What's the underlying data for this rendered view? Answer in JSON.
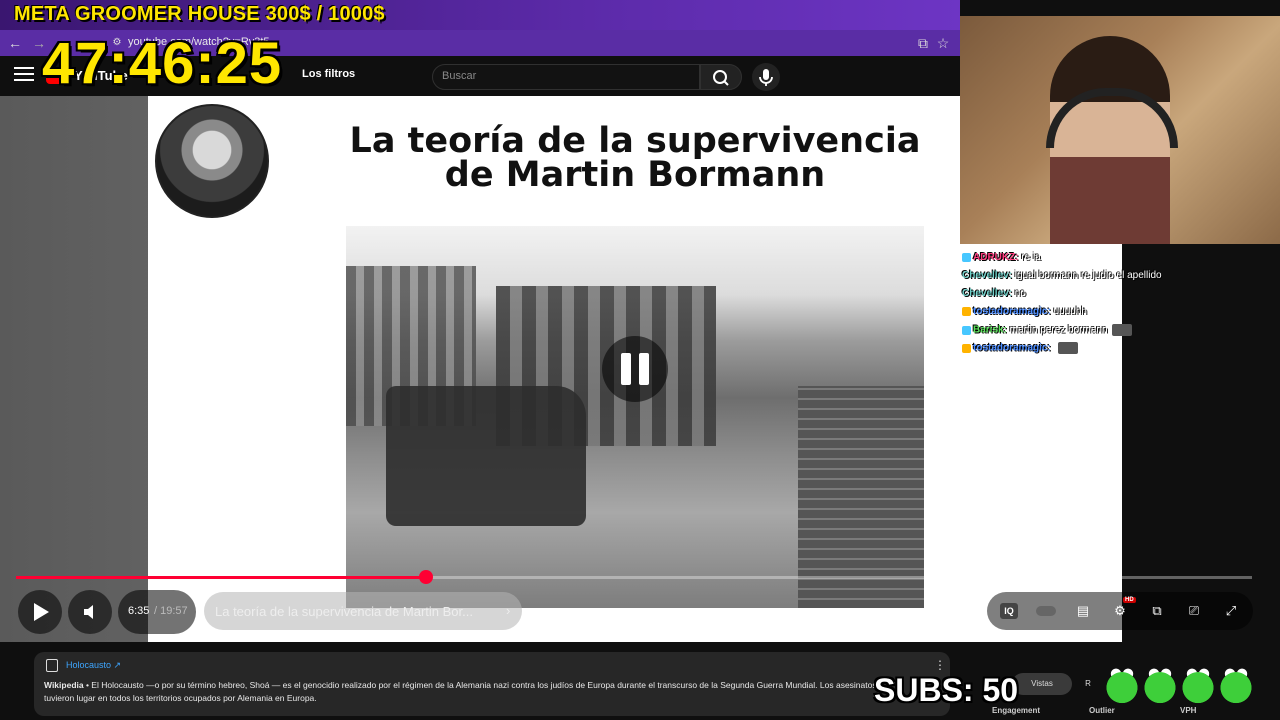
{
  "stream_overlay": {
    "banner": "META GROOMER HOUSE 300$ / 1000$",
    "timer": "47:46:25",
    "subs": "SUBS: 50"
  },
  "browser": {
    "url": "youtube.com/watch?v=Rv3t5..."
  },
  "youtube_header": {
    "logo_text": "YouTube",
    "filters_label": "Los filtros",
    "search_placeholder": "Buscar"
  },
  "slide": {
    "title_line1": "La teoría de la supervivencia",
    "title_line2": "de Martin Bormann"
  },
  "player": {
    "current_time": "6:35",
    "total_time": "/ 19:57",
    "chapter": "La teoría de la supervivencia de Martin Bor...",
    "chapter_arrow": "›",
    "progress": 0.332
  },
  "chat": [
    {
      "name": "ADRUKZ",
      "message": "re ia",
      "color": "#ff3d7f"
    },
    {
      "name": "Chevellev",
      "message": "igual bormann re judio el apellido",
      "color": "#6fd0c9"
    },
    {
      "name": "Chevellev",
      "message": "no",
      "color": "#6fd0c9"
    },
    {
      "name": "tostadoramagic",
      "message": "uuuuhh",
      "color": "#4a8cff"
    },
    {
      "name": "Barisk",
      "message": "martin perez bormann",
      "color": "#5be35b"
    },
    {
      "name": "tostadoramagic",
      "message": "",
      "color": "#4a8cff"
    }
  ],
  "info_card": {
    "link": "Holocausto ↗",
    "source": "Wikipedia",
    "text": " • El Holocausto —o por su término hebreo, Shoá — es el genocidio realizado por el régimen de la Alemania nazi contra los judíos de Europa durante el transcurso de la Segunda Guerra Mundial. Los asesinatos tuvieron lugar en todos los territorios ocupados por Alemania en Europa."
  },
  "extension": {
    "tab_views": "Vistas",
    "tab_r": "R",
    "labels": [
      "Engagement",
      "Outlier",
      "VPH"
    ]
  }
}
